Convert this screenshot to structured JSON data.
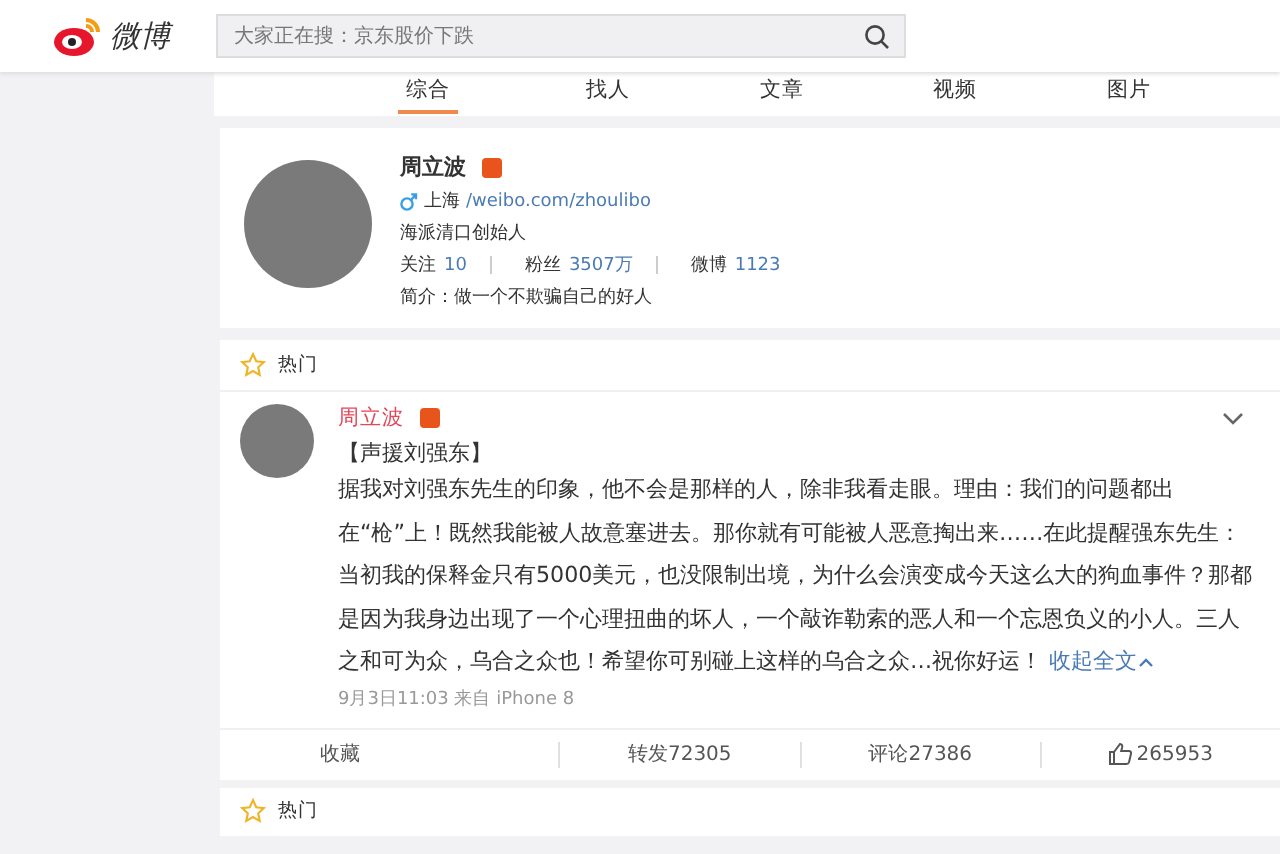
{
  "header": {
    "logo_text": "微博",
    "search": {
      "placeholder": "大家正在搜：京东股价下跌"
    }
  },
  "tabs": [
    {
      "label": "综合",
      "selected": true
    },
    {
      "label": "找人",
      "selected": false
    },
    {
      "label": "文章",
      "selected": false
    },
    {
      "label": "视频",
      "selected": false
    },
    {
      "label": "图片",
      "selected": false
    }
  ],
  "profile": {
    "name": "周立波",
    "verified": true,
    "location": "上海",
    "url": "/weibo.com/zhoulibo",
    "title": "海派清口创始人",
    "stats": [
      {
        "label": "关注",
        "value": "10"
      },
      {
        "label": "粉丝",
        "value": "3507万"
      },
      {
        "label": "微博",
        "value": "1123"
      }
    ],
    "bio": "简介：做一个不欺骗自己的好人"
  },
  "hot_section": {
    "label": "热门",
    "post": {
      "author": "周立波",
      "verified": true,
      "headline": "【声援刘强东】",
      "text": "据我对刘强东先生的印象，他不会是那样的人，除非我看走眼。理由：我们的问题都出在“枪”上！既然我能被人故意塞进去。那你就有可能被人恶意掏出来……在此提醒强东先生：当初我的保释金只有5000美元，也没限制出境，为什么会演变成今天这么大的狗血事件？那都是因为我身边出现了一个心理扭曲的坏人，一个敲诈勒索的恶人和一个忘恩负义的小人。三人之和可为众，乌合之众也！希望你可别碰上这样的乌合之众…祝你好运！",
      "collapse_link": "收起全文",
      "meta": "9月3日11:03 来自 iPhone 8",
      "actions": [
        {
          "kind": "favorite",
          "label": "收藏"
        },
        {
          "kind": "repost",
          "label": "转发72305"
        },
        {
          "kind": "comment",
          "label": "评论27386"
        },
        {
          "kind": "like",
          "label": "265953"
        }
      ]
    }
  },
  "next_section": {
    "label": "热门"
  }
}
